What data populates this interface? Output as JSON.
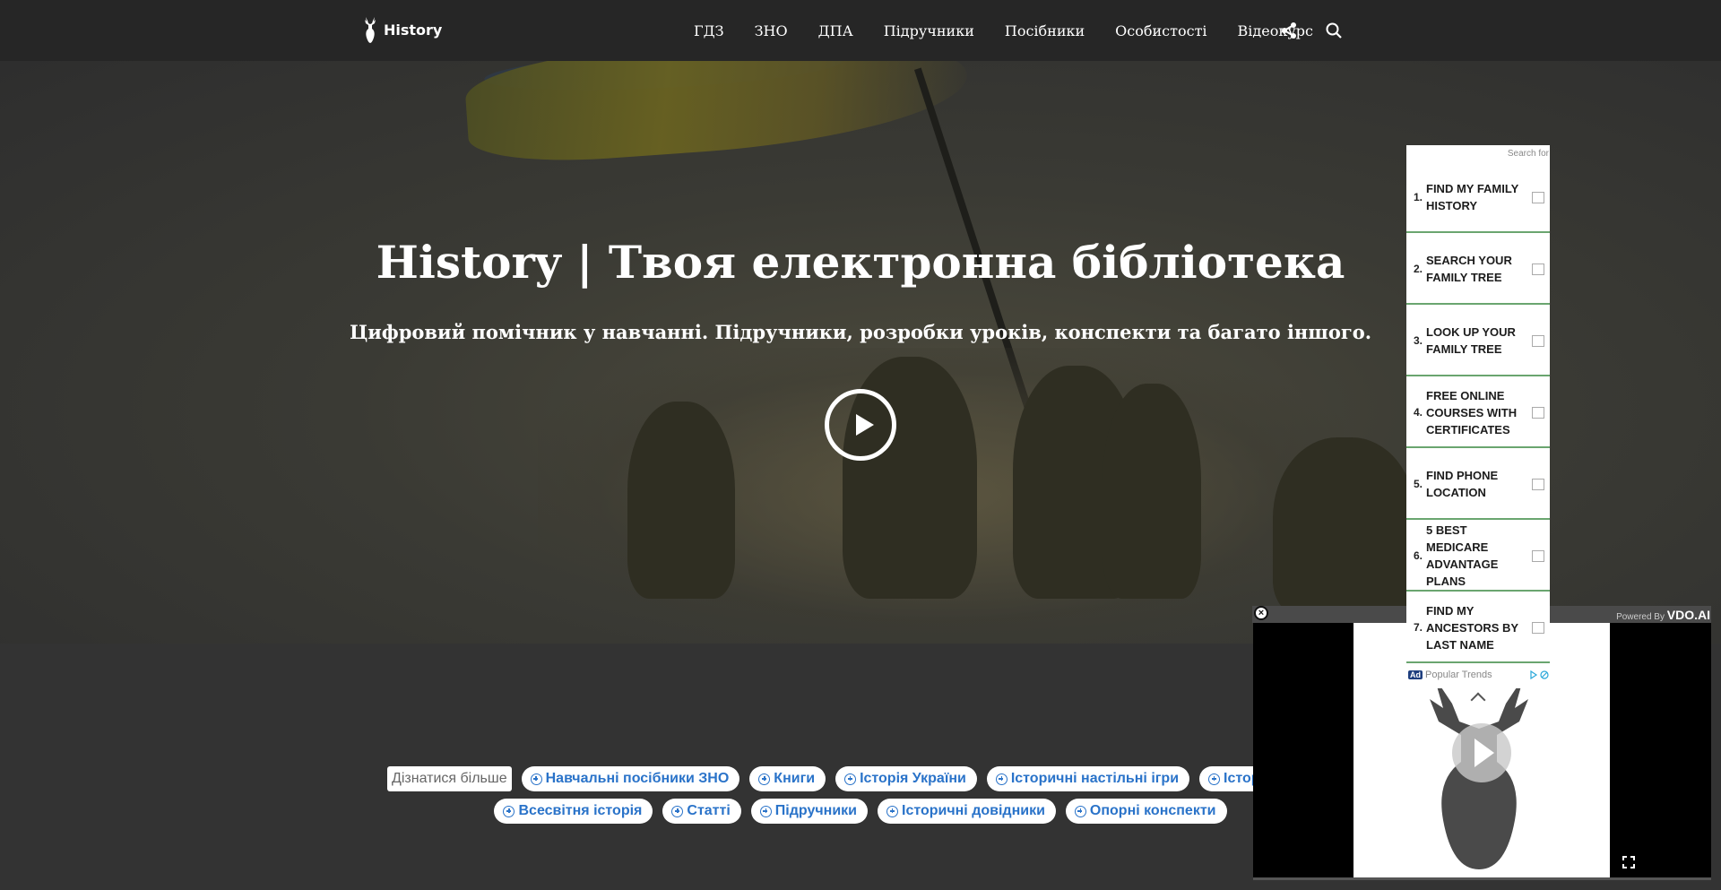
{
  "header": {
    "logo_text": "History",
    "nav": [
      "ГДЗ",
      "ЗНО",
      "ДПА",
      "Підручники",
      "Посібники",
      "Особистості",
      "Відеокурс"
    ]
  },
  "hero": {
    "title": "History | Твоя електронна бібліотека",
    "subtitle": "Цифровий помічник у навчанні. Підручники, розробки уроків, конспекти та багато іншого."
  },
  "tags": {
    "learn_more": "Дізнатися більше",
    "row1": [
      "Навчальні посібники ЗНО",
      "Книги",
      "Історія України",
      "Історичні настільні ігри",
      "Історич"
    ],
    "row2": [
      "Всесвітня історія",
      "Статті",
      "Підручники",
      "Історичні довідники",
      "Опорні конспекти"
    ]
  },
  "ad": {
    "search_for": "Search for",
    "items": [
      {
        "num": "1.",
        "label": "FIND MY FAMILY HISTORY"
      },
      {
        "num": "2.",
        "label": "SEARCH YOUR FAMILY TREE"
      },
      {
        "num": "3.",
        "label": "LOOK UP YOUR FAMILY TREE"
      },
      {
        "num": "4.",
        "label": "FREE ONLINE COURSES WITH CERTIFICATES"
      },
      {
        "num": "5.",
        "label": "FIND PHONE LOCATION"
      },
      {
        "num": "6.",
        "label": "5 BEST MEDICARE ADVANTAGE PLANS"
      },
      {
        "num": "7.",
        "label": "FIND MY ANCESTORS BY LAST NAME"
      }
    ],
    "badge": "Ad",
    "footer": "Popular Trends"
  },
  "video": {
    "powered_by": "Powered By",
    "brand": "VDO.AI",
    "close": "×"
  },
  "colors": {
    "header_bg": "#262626",
    "page_bg": "#333333",
    "tag_text": "#2a73c9",
    "ad_divider": "#6aa56f"
  }
}
